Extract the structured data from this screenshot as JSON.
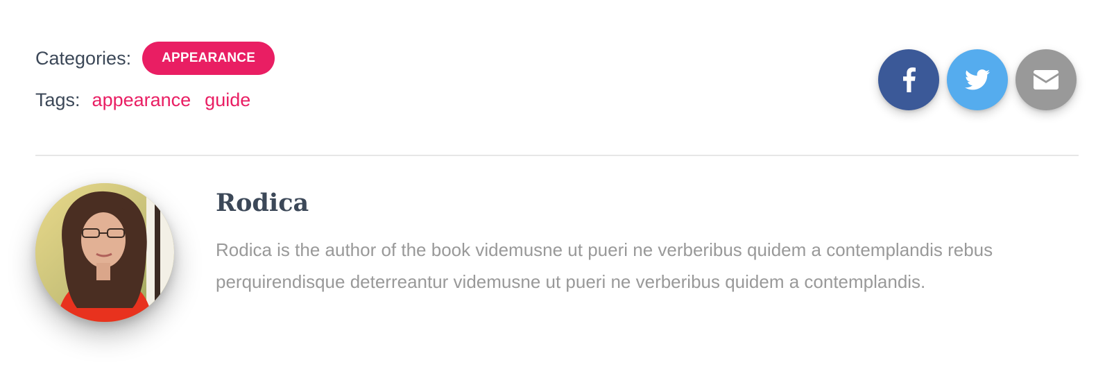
{
  "post_meta": {
    "categories_label": "Categories:",
    "category_badge": "APPEARANCE",
    "tags_label": "Tags:",
    "tags": [
      "appearance",
      "guide"
    ]
  },
  "share": {
    "buttons": [
      {
        "name": "facebook",
        "icon": "facebook-icon",
        "color": "#3b5998"
      },
      {
        "name": "twitter",
        "icon": "twitter-icon",
        "color": "#55acee"
      },
      {
        "name": "email",
        "icon": "email-icon",
        "color": "#999999"
      }
    ]
  },
  "author": {
    "name": "Rodica",
    "bio": "Rodica is the author of the book videmusne ut pueri ne verberibus quidem a contemplandis rebus perquirendisque deterreantur videmusne ut pueri ne verberibus quidem a contemplandis.",
    "avatar_icon": "author-avatar"
  },
  "colors": {
    "accent": "#e91e63",
    "heading": "#3c4858",
    "muted": "#999999",
    "divider": "#e6e6e6"
  }
}
